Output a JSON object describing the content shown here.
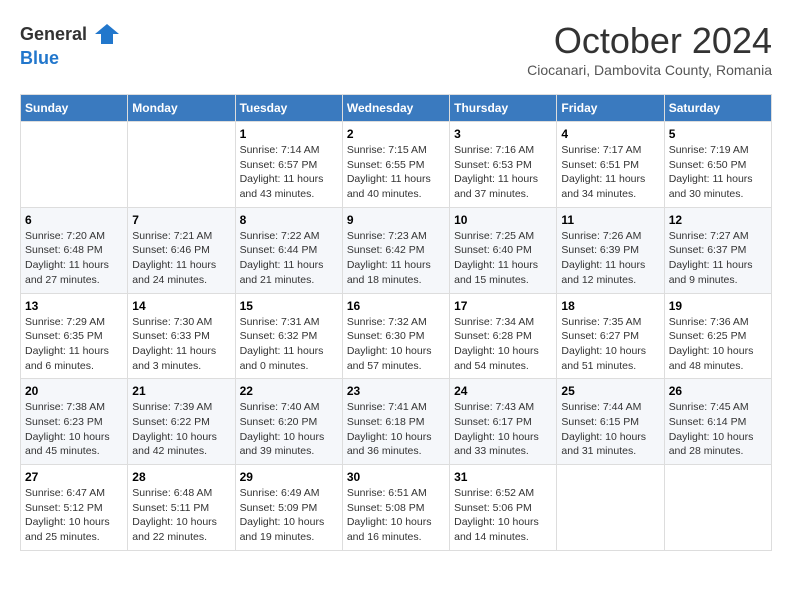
{
  "logo": {
    "general": "General",
    "blue": "Blue",
    "bird_icon": "▶"
  },
  "header": {
    "month": "October 2024",
    "subtitle": "Ciocanari, Dambovita County, Romania"
  },
  "weekdays": [
    "Sunday",
    "Monday",
    "Tuesday",
    "Wednesday",
    "Thursday",
    "Friday",
    "Saturday"
  ],
  "weeks": [
    [
      {
        "day": "",
        "info": ""
      },
      {
        "day": "",
        "info": ""
      },
      {
        "day": "1",
        "info": "Sunrise: 7:14 AM\nSunset: 6:57 PM\nDaylight: 11 hours and 43 minutes."
      },
      {
        "day": "2",
        "info": "Sunrise: 7:15 AM\nSunset: 6:55 PM\nDaylight: 11 hours and 40 minutes."
      },
      {
        "day": "3",
        "info": "Sunrise: 7:16 AM\nSunset: 6:53 PM\nDaylight: 11 hours and 37 minutes."
      },
      {
        "day": "4",
        "info": "Sunrise: 7:17 AM\nSunset: 6:51 PM\nDaylight: 11 hours and 34 minutes."
      },
      {
        "day": "5",
        "info": "Sunrise: 7:19 AM\nSunset: 6:50 PM\nDaylight: 11 hours and 30 minutes."
      }
    ],
    [
      {
        "day": "6",
        "info": "Sunrise: 7:20 AM\nSunset: 6:48 PM\nDaylight: 11 hours and 27 minutes."
      },
      {
        "day": "7",
        "info": "Sunrise: 7:21 AM\nSunset: 6:46 PM\nDaylight: 11 hours and 24 minutes."
      },
      {
        "day": "8",
        "info": "Sunrise: 7:22 AM\nSunset: 6:44 PM\nDaylight: 11 hours and 21 minutes."
      },
      {
        "day": "9",
        "info": "Sunrise: 7:23 AM\nSunset: 6:42 PM\nDaylight: 11 hours and 18 minutes."
      },
      {
        "day": "10",
        "info": "Sunrise: 7:25 AM\nSunset: 6:40 PM\nDaylight: 11 hours and 15 minutes."
      },
      {
        "day": "11",
        "info": "Sunrise: 7:26 AM\nSunset: 6:39 PM\nDaylight: 11 hours and 12 minutes."
      },
      {
        "day": "12",
        "info": "Sunrise: 7:27 AM\nSunset: 6:37 PM\nDaylight: 11 hours and 9 minutes."
      }
    ],
    [
      {
        "day": "13",
        "info": "Sunrise: 7:29 AM\nSunset: 6:35 PM\nDaylight: 11 hours and 6 minutes."
      },
      {
        "day": "14",
        "info": "Sunrise: 7:30 AM\nSunset: 6:33 PM\nDaylight: 11 hours and 3 minutes."
      },
      {
        "day": "15",
        "info": "Sunrise: 7:31 AM\nSunset: 6:32 PM\nDaylight: 11 hours and 0 minutes."
      },
      {
        "day": "16",
        "info": "Sunrise: 7:32 AM\nSunset: 6:30 PM\nDaylight: 10 hours and 57 minutes."
      },
      {
        "day": "17",
        "info": "Sunrise: 7:34 AM\nSunset: 6:28 PM\nDaylight: 10 hours and 54 minutes."
      },
      {
        "day": "18",
        "info": "Sunrise: 7:35 AM\nSunset: 6:27 PM\nDaylight: 10 hours and 51 minutes."
      },
      {
        "day": "19",
        "info": "Sunrise: 7:36 AM\nSunset: 6:25 PM\nDaylight: 10 hours and 48 minutes."
      }
    ],
    [
      {
        "day": "20",
        "info": "Sunrise: 7:38 AM\nSunset: 6:23 PM\nDaylight: 10 hours and 45 minutes."
      },
      {
        "day": "21",
        "info": "Sunrise: 7:39 AM\nSunset: 6:22 PM\nDaylight: 10 hours and 42 minutes."
      },
      {
        "day": "22",
        "info": "Sunrise: 7:40 AM\nSunset: 6:20 PM\nDaylight: 10 hours and 39 minutes."
      },
      {
        "day": "23",
        "info": "Sunrise: 7:41 AM\nSunset: 6:18 PM\nDaylight: 10 hours and 36 minutes."
      },
      {
        "day": "24",
        "info": "Sunrise: 7:43 AM\nSunset: 6:17 PM\nDaylight: 10 hours and 33 minutes."
      },
      {
        "day": "25",
        "info": "Sunrise: 7:44 AM\nSunset: 6:15 PM\nDaylight: 10 hours and 31 minutes."
      },
      {
        "day": "26",
        "info": "Sunrise: 7:45 AM\nSunset: 6:14 PM\nDaylight: 10 hours and 28 minutes."
      }
    ],
    [
      {
        "day": "27",
        "info": "Sunrise: 6:47 AM\nSunset: 5:12 PM\nDaylight: 10 hours and 25 minutes."
      },
      {
        "day": "28",
        "info": "Sunrise: 6:48 AM\nSunset: 5:11 PM\nDaylight: 10 hours and 22 minutes."
      },
      {
        "day": "29",
        "info": "Sunrise: 6:49 AM\nSunset: 5:09 PM\nDaylight: 10 hours and 19 minutes."
      },
      {
        "day": "30",
        "info": "Sunrise: 6:51 AM\nSunset: 5:08 PM\nDaylight: 10 hours and 16 minutes."
      },
      {
        "day": "31",
        "info": "Sunrise: 6:52 AM\nSunset: 5:06 PM\nDaylight: 10 hours and 14 minutes."
      },
      {
        "day": "",
        "info": ""
      },
      {
        "day": "",
        "info": ""
      }
    ]
  ]
}
